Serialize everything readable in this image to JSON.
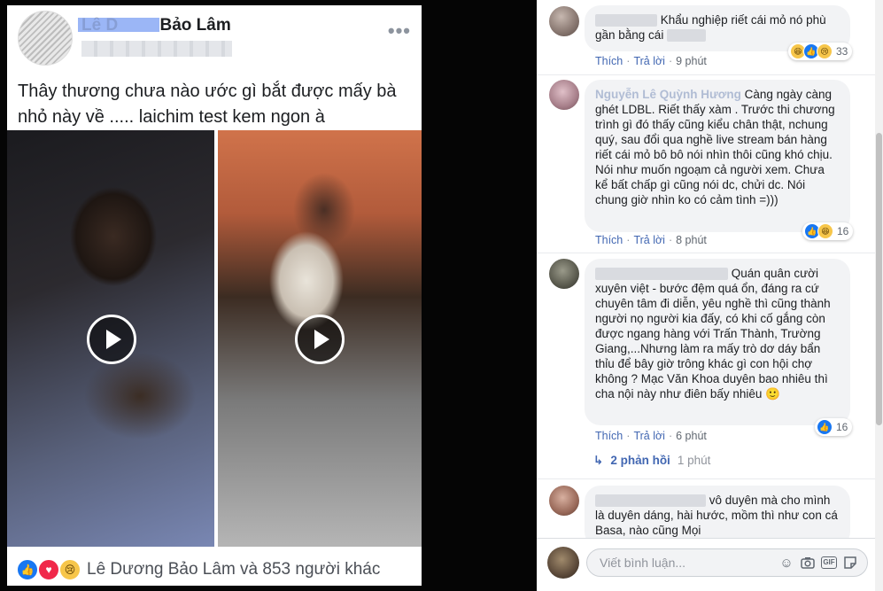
{
  "post": {
    "author_name": "Bảo Lâm",
    "author_prefix": "Lê D",
    "text": "Thây thương chưa nào ước gì bắt được mấy bà nhỏ này về ..... laichim test kem ngon à",
    "reactions_summary": "Lê Dương Bảo Lâm và 853 người khác",
    "more_label": "•••"
  },
  "comments": [
    {
      "name": "",
      "text": "Khẩu nghiệp riết cái mỏ nó phù gần bằng cái",
      "like_label": "Thích",
      "reply_label": "Trả lời",
      "time": "9 phút",
      "reaction_count": "33",
      "reactions": [
        "haha-icon",
        "like-icon",
        "sad-icon"
      ]
    },
    {
      "name": "Nguyễn Lê Quỳnh Hương",
      "text": "Càng ngày càng ghét LDBL. Riết thấy xàm . Trước thi chương trình gì đó thấy cũng kiểu chân thật, nchung quý, sau đổi qua nghề live stream bán hàng riết cái mỏ bô bô nói nhìn thôi cũng khó chịu. Nói như muốn ngoạm cả người xem. Chưa kể bất chấp gì cũng nói dc, chửi dc. Nói chung giờ nhìn ko có cảm tình =)))",
      "like_label": "Thích",
      "reply_label": "Trả lời",
      "time": "8 phút",
      "reaction_count": "16",
      "reactions": [
        "like-icon",
        "haha-icon"
      ]
    },
    {
      "name": "",
      "text": "Quán quân cười xuyên việt - bước đệm quá ổn, đáng ra cứ chuyên tâm đi diễn, yêu nghề thì cũng thành người nọ người kia đấy, có khi cố gắng còn được ngang hàng với Trấn Thành, Trường Giang,...Nhưng làm ra mấy trò dơ dáy bẩn thỉu để bây giờ trông khác gì con hội chợ không ? Mạc Văn Khoa duyên bao nhiêu thì cha nội này như điên bấy nhiêu 🙂",
      "like_label": "Thích",
      "reply_label": "Trả lời",
      "time": "6 phút",
      "reaction_count": "16",
      "reactions": [
        "like-icon"
      ]
    },
    {
      "name": "",
      "text": "vô duyên mà cho mình là duyên dáng, hài hước, mồm thì như con cá Basa, nào cũng Mọi"
    }
  ],
  "replies": {
    "label": "2 phản hồi",
    "time": "1 phút"
  },
  "composer": {
    "placeholder": "Viết bình luận..."
  },
  "colors": {
    "link": "#4267b2",
    "like": "#1877f2",
    "love": "#f0284a",
    "bubble": "#f2f3f5"
  }
}
